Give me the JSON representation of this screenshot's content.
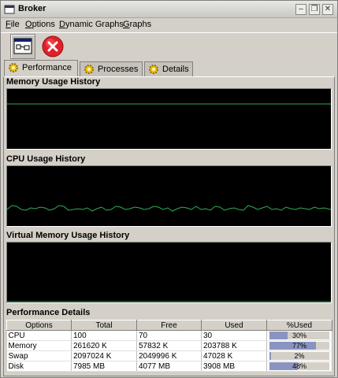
{
  "window": {
    "title": "Broker"
  },
  "menu": [
    {
      "label": "File",
      "underline": "F",
      "rest": "ile"
    },
    {
      "label": "Options",
      "underline": "O",
      "rest": "ptions"
    },
    {
      "label": "Dynamic Graphs",
      "underline": "D",
      "rest": "ynamic Graphs"
    },
    {
      "label": "Graphs",
      "underline": "G",
      "rest": "raphs"
    }
  ],
  "toolbar": {
    "monitor_icon": "monitor-icon",
    "stop_icon": "stop-icon"
  },
  "tabs": [
    {
      "label": "Performance",
      "active": true
    },
    {
      "label": "Processes",
      "active": false
    },
    {
      "label": "Details",
      "active": false
    }
  ],
  "sections": {
    "memory": "Memory Usage History",
    "cpu": "CPU Usage History",
    "virtual": "Virtual Memory Usage History",
    "details": "Performance Details"
  },
  "colors": {
    "graph_bg": "#000000",
    "graph_line": "#2fae55",
    "bar_fill": "#8a94c0"
  },
  "table": {
    "columns": [
      "Options",
      "Total",
      "Free",
      "Used",
      "%Used"
    ],
    "rows": [
      {
        "name": "CPU",
        "total": "100",
        "free": "70",
        "used": "30",
        "pct_label": "30%",
        "pct": 30
      },
      {
        "name": "Memory",
        "total": "261620 K",
        "free": "57832 K",
        "used": "203788 K",
        "pct_label": "77%",
        "pct": 77
      },
      {
        "name": "Swap",
        "total": "2097024 K",
        "free": "2049996 K",
        "used": "47028 K",
        "pct_label": "2%",
        "pct": 2
      },
      {
        "name": "Disk",
        "total": "7985 MB",
        "free": "4077 MB",
        "used": "3908 MB",
        "pct_label": "48%",
        "pct": 48
      }
    ]
  }
}
